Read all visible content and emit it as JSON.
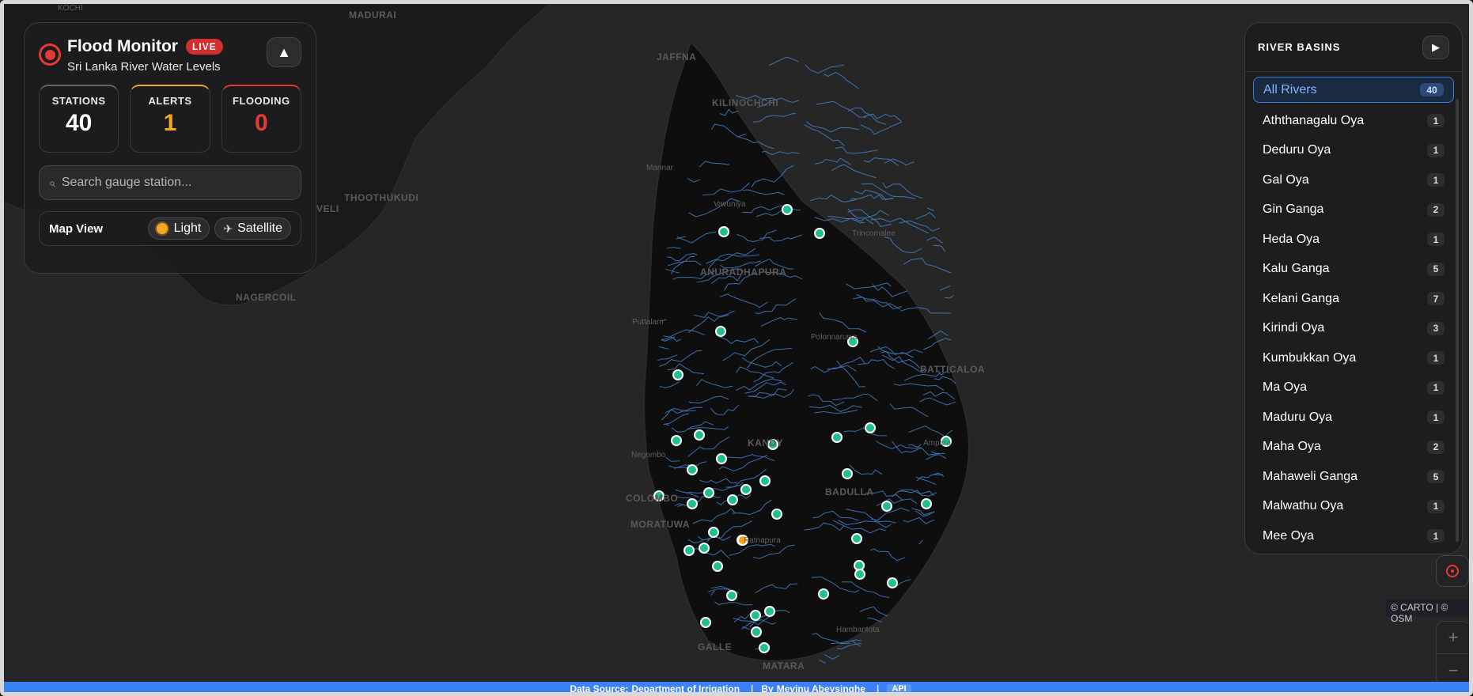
{
  "header": {
    "title": "Flood Monitor",
    "live_badge": "LIVE",
    "subtitle": "Sri Lanka River Water Levels",
    "collapse_icon": "chevron-up-icon"
  },
  "stats": [
    {
      "label": "STATIONS",
      "value": "40",
      "color": "#ffffff"
    },
    {
      "label": "ALERTS",
      "value": "1",
      "color": "#f5a623"
    },
    {
      "label": "FLOODING",
      "value": "0",
      "color": "#e53935"
    }
  ],
  "search": {
    "placeholder": "Search gauge station..."
  },
  "map_view": {
    "label": "Map View",
    "options": [
      {
        "label": "Light",
        "icon": "sun-icon"
      },
      {
        "label": "Satellite",
        "icon": "satellite-icon"
      }
    ]
  },
  "river_panel": {
    "title": "RIVER BASINS",
    "play_icon": "play-icon",
    "items": [
      {
        "name": "All Rivers",
        "count": "40",
        "active": true
      },
      {
        "name": "Aththanagalu Oya",
        "count": "1"
      },
      {
        "name": "Deduru Oya",
        "count": "1"
      },
      {
        "name": "Gal Oya",
        "count": "1"
      },
      {
        "name": "Gin Ganga",
        "count": "2"
      },
      {
        "name": "Heda Oya",
        "count": "1"
      },
      {
        "name": "Kalu Ganga",
        "count": "5"
      },
      {
        "name": "Kelani Ganga",
        "count": "7"
      },
      {
        "name": "Kirindi Oya",
        "count": "3"
      },
      {
        "name": "Kumbukkan Oya",
        "count": "1"
      },
      {
        "name": "Ma Oya",
        "count": "1"
      },
      {
        "name": "Maduru Oya",
        "count": "1"
      },
      {
        "name": "Maha Oya",
        "count": "2"
      },
      {
        "name": "Mahaweli Ganga",
        "count": "5"
      },
      {
        "name": "Malwathu Oya",
        "count": "1"
      },
      {
        "name": "Mee Oya",
        "count": "1"
      }
    ]
  },
  "map": {
    "labels": [
      {
        "text": "KOCHI"
      },
      {
        "text": "MADURAI"
      },
      {
        "text": "THOOTHUKUDI"
      },
      {
        "text": "NAGERCOIL"
      },
      {
        "text": "JAFFNA"
      },
      {
        "text": "KILINOCHCHI"
      },
      {
        "text": "Mannar"
      },
      {
        "text": "Vavuniya"
      },
      {
        "text": "Trincomalee"
      },
      {
        "text": "ANURADHAPURA"
      },
      {
        "text": "Puttalam"
      },
      {
        "text": "Polonnaruwa"
      },
      {
        "text": "BATTICALOA"
      },
      {
        "text": "Negombo"
      },
      {
        "text": "COLOMBO"
      },
      {
        "text": "MORATUWA"
      },
      {
        "text": "BADULLA"
      },
      {
        "text": "Hambantota"
      },
      {
        "text": "GALLE"
      },
      {
        "text": "MATARA"
      },
      {
        "text": "KANDY"
      },
      {
        "text": "VELI"
      },
      {
        "text": "Ampara"
      },
      {
        "text": "Ratnapura"
      }
    ],
    "station_colors": {
      "normal": "#1fbf8f",
      "alert": "#f5a623"
    },
    "river_color": "#4a8fe0"
  },
  "attribution": "© CARTO | © OSM",
  "zoom": {
    "in": "+",
    "out": "−"
  },
  "footer": {
    "source_prefix": "Data Source:",
    "source_link": "Department of Irrigation",
    "sep": "|",
    "by_prefix": "By",
    "author": "Mevinu Abeysinghe",
    "api": "API"
  }
}
